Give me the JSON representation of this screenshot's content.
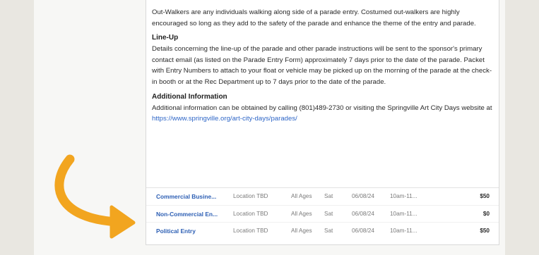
{
  "body": {
    "outwalkers_text": "Out-Walkers are any individuals walking along side of a parade entry. Costumed out-walkers are highly encouraged so long as they add to the safety of the parade and enhance the theme of the entry and parade.",
    "lineup_heading": "Line-Up",
    "lineup_text": "Details concerning the line-up of the parade and other parade instructions will be sent to the sponsor's primary contact email (as listed on the Parade Entry Form) approximately 7 days prior to the date of the parade. Packet with Entry Numbers to attach to your float or vehicle may be picked up on the morning of the parade at the check-in booth or at the Rec Department up to 7 days prior to the date of the parade.",
    "additional_heading": "Additional Information",
    "additional_text": "Additional information can be obtained by calling (801)489-2730 or visiting the Springville Art City Days website at ",
    "additional_link": "https://www.springville.org/art-city-days/parades/"
  },
  "entries": [
    {
      "name": "Commercial Busine...",
      "location": "Location TBD",
      "ages": "All Ages",
      "day": "Sat",
      "date": "06/08/24",
      "time": "10am-11...",
      "price": "$50"
    },
    {
      "name": "Non-Commercial En...",
      "location": "Location TBD",
      "ages": "All Ages",
      "day": "Sat",
      "date": "06/08/24",
      "time": "10am-11...",
      "price": "$0"
    },
    {
      "name": "Political Entry",
      "location": "Location TBD",
      "ages": "All Ages",
      "day": "Sat",
      "date": "06/08/24",
      "time": "10am-11...",
      "price": "$50"
    }
  ],
  "colors": {
    "arrow": "#f2a51f",
    "link": "#2e66c7"
  },
  "icons": {
    "arrow": "curved-arrow-icon"
  }
}
